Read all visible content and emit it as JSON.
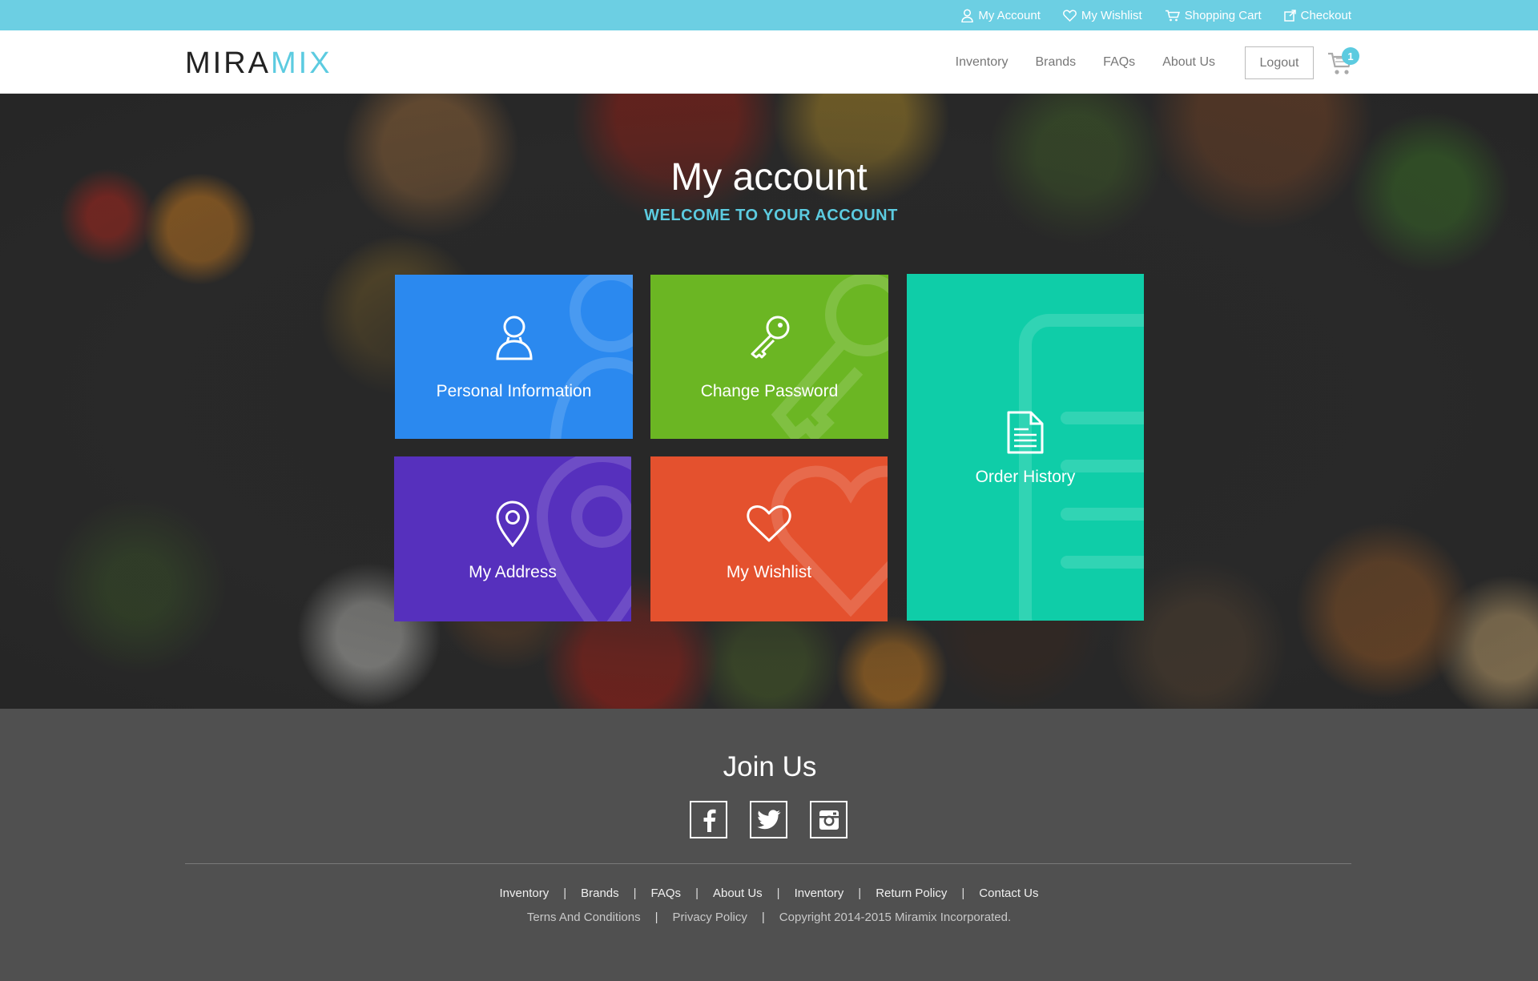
{
  "topbar": {
    "links": [
      {
        "label": "My Account",
        "icon": "user-icon"
      },
      {
        "label": "My Wishlist",
        "icon": "heart-icon"
      },
      {
        "label": "Shopping Cart",
        "icon": "cart-icon"
      },
      {
        "label": "Checkout",
        "icon": "checkout-icon"
      }
    ]
  },
  "header": {
    "logo_part1": "MIRA",
    "logo_part2": "MIX",
    "nav": [
      "Inventory",
      "Brands",
      "FAQs",
      "About Us"
    ],
    "logout_label": "Logout",
    "cart_count": "1"
  },
  "hero": {
    "title": "My account",
    "subtitle": "WELCOME TO YOUR ACCOUNT",
    "tiles": [
      {
        "label": "Personal Information",
        "color": "#2b89ef",
        "icon": "user-icon"
      },
      {
        "label": "Change Password",
        "color": "#6bb623",
        "icon": "key-icon"
      },
      {
        "label": "Order History",
        "color": "#0fcda8",
        "icon": "document-icon"
      },
      {
        "label": "My Address",
        "color": "#5630bd",
        "icon": "location-pin-icon"
      },
      {
        "label": "My Wishlist",
        "color": "#e4512e",
        "icon": "heart-icon"
      }
    ]
  },
  "footer": {
    "join_title": "Join Us",
    "social": [
      "facebook-icon",
      "twitter-icon",
      "instagram-icon"
    ],
    "links_row1": [
      "Inventory",
      "Brands",
      "FAQs",
      "About Us",
      "Inventory",
      "Return Policy",
      "Contact Us"
    ],
    "links_row2": [
      "Terns And Conditions",
      "Privacy Policy"
    ],
    "copyright": "Copyright 2014-2015 Miramix Incorporated."
  },
  "colors": {
    "accent": "#5ccbe0",
    "topbar": "#6ccfe3",
    "footer": "#505050"
  }
}
